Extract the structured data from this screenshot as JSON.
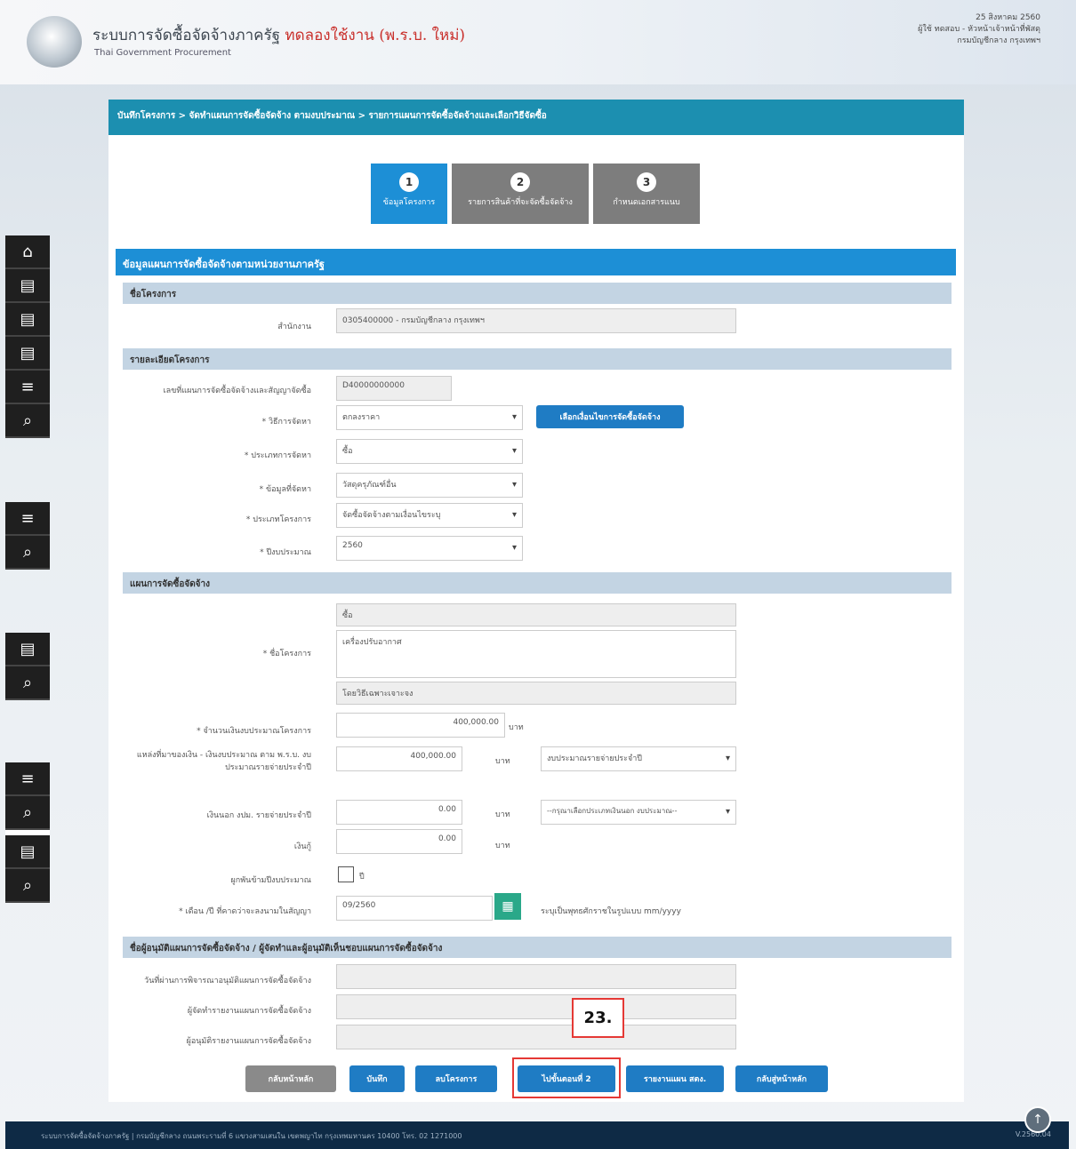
{
  "header": {
    "app_title": "ระบบการจัดซื้อจัดจ้างภาครัฐ",
    "env_label": "ทดลองใช้งาน (พ.ร.บ. ใหม่)",
    "app_subtitle": "Thai Government Procurement",
    "date": "25 สิงหาคม 2560",
    "user": "ผู้ใช้ ทดสอบ - หัวหน้าเจ้าหน้าที่พัสดุ",
    "org": "กรมบัญชีกลาง กรุงเทพฯ"
  },
  "breadcrumb": "บันทึกโครงการ > จัดทำแผนการจัดซื้อจัดจ้าง ตามงบประมาณ > รายการแผนการจัดซื้อจัดจ้างและเลือกวิธีจัดซื้อ",
  "steps": [
    {
      "num": "1",
      "label": "ข้อมูลโครงการ"
    },
    {
      "num": "2",
      "label": "รายการสินค้าที่จะจัดซื้อจัดจ้าง"
    },
    {
      "num": "3",
      "label": "กำหนดเอกสารแนบ"
    }
  ],
  "section_title": "ข้อมูลแผนการจัดซื้อจัดจ้างตามหน่วยงานภาครัฐ",
  "subheads": {
    "agency": "ชื่อโครงการ",
    "details": "รายละเอียดโครงการ",
    "plan": "แผนการจัดซื้อจัดจ้าง",
    "approver": "ชื่อผู้อนุมัติแผนการจัดซื้อจัดจ้าง / ผู้จัดทำและผู้อนุมัติเห็นชอบแผนการจัดซื้อจัดจ้าง"
  },
  "form": {
    "agency_label": "สำนักงาน",
    "agency_value": "0305400000 - กรมบัญชีกลาง กรุงเทพฯ",
    "plan_no_label": "เลขที่แผนการจัดซื้อจัดจ้างและสัญญาจัดซื้อ",
    "plan_no_value": "D40000000000",
    "method_label": "* วิธีการจัดหา",
    "method_value": "ตกลงราคา",
    "method_button": "เลือกเงื่อนไขการจัดซื้อจัดจ้าง",
    "type_label": "* ประเภทการจัดหา",
    "type_value": "ซื้อ",
    "category_label": "* ข้อมูลที่จัดหา",
    "category_value": "วัสดุครุภัณฑ์อื่น",
    "project_type_label": "* ประเภทโครงการ",
    "project_type_value": "จัดซื้อจัดจ้างตามเงื่อนไขระบุ",
    "budget_year_label": "* ปีงบประมาณ",
    "budget_year_value": "2560",
    "project_name_label": "* ชื่อโครงการ",
    "project_prefix": "ซื้อ",
    "project_name_value": "เครื่องปรับอากาศ",
    "project_suffix": "โดยวิธีเฉพาะเจาะจง",
    "amount_label": "* จำนวนเงินงบประมาณโครงการ",
    "amount_value": "400,000.00",
    "amount_unit": "บาท",
    "source_label": "แหล่งที่มาของเงิน - เงินงบประมาณ ตาม พ.ร.บ. งบประมาณรายจ่ายประจำปี",
    "source_value": "400,000.00",
    "source_unit": "บาท",
    "source_select": "งบประมาณรายจ่ายประจำปี",
    "other_label": "เงินนอก งปม. รายจ่ายประจำปี",
    "other_value": "0.00",
    "other_unit": "บาท",
    "other_select": "--กรุณาเลือกประเภทเงินนอก งบประมาณ--",
    "loan_label": "เงินกู้",
    "loan_value": "0.00",
    "loan_unit": "บาท",
    "multiyear_label": "ผูกพันข้ามปีงบประมาณ",
    "multiyear_check": "ปี",
    "date_label": "* เดือน /ปี ที่คาดว่าจะลงนามในสัญญา",
    "date_value": "09/2560",
    "date_hint": "ระบุเป็นพุทธศักราชในรูปแบบ mm/yyyy",
    "approver1_label": "วันที่ผ่านการพิจารณาอนุมัติแผนการจัดซื้อจัดจ้าง",
    "approver2_label": "ผู้จัดทำรายงานแผนการจัดซื้อจัดจ้าง",
    "approver3_label": "ผู้อนุมัติรายงานแผนการจัดซื้อจัดจ้าง"
  },
  "buttons": {
    "back": "กลับหน้าหลัก",
    "save": "บันทึก",
    "delete": "ลบโครงการ",
    "next": "ไปขั้นตอนที่ 2",
    "report": "รายงานแผน สตง.",
    "main": "กลับสู่หน้าหลัก"
  },
  "callout": "23.",
  "footer": {
    "text": "ระบบการจัดซื้อจัดจ้างภาครัฐ | กรมบัญชีกลาง ถนนพระรามที่ 6 แขวงสามเสนใน เขตพญาไท กรุงเทพมหานคร 10400 โทร. 02 1271000",
    "version": "V.2560.04"
  },
  "colors": {
    "brand": "#1d8fd6",
    "breadcrumb": "#1c8fb0",
    "step_active": "#1d8fd6",
    "step_inactive": "#7d7d7d",
    "highlight": "#e53935"
  }
}
